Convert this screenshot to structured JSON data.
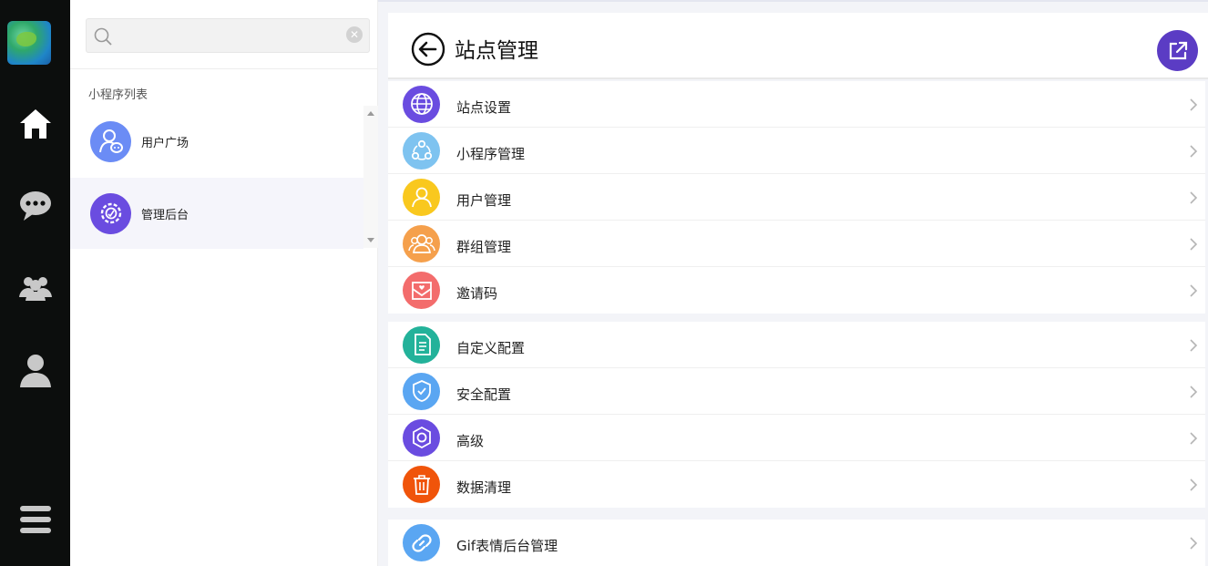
{
  "search": {
    "placeholder": ""
  },
  "sidebar": {
    "section_title": "小程序列表",
    "items": [
      {
        "label": "用户广场",
        "icon": "user-plaza-icon",
        "color": "#6b8cf5"
      },
      {
        "label": "管理后台",
        "icon": "admin-gear-icon",
        "color": "#6a4ce0"
      }
    ]
  },
  "header": {
    "title": "站点管理"
  },
  "menu_groups": [
    [
      {
        "label": "站点设置",
        "icon": "globe-icon",
        "color": "#6a4ce0"
      },
      {
        "label": "小程序管理",
        "icon": "share-nodes-icon",
        "color": "#7ec3f0"
      },
      {
        "label": "用户管理",
        "icon": "user-icon",
        "color": "#f9c81e"
      },
      {
        "label": "群组管理",
        "icon": "group-icon",
        "color": "#f5a04c"
      },
      {
        "label": "邀请码",
        "icon": "envelope-icon",
        "color": "#f36c6c"
      }
    ],
    [
      {
        "label": "自定义配置",
        "icon": "document-icon",
        "color": "#23b29a"
      },
      {
        "label": "安全配置",
        "icon": "shield-check-icon",
        "color": "#5aa6f2"
      },
      {
        "label": "高级",
        "icon": "gear-icon",
        "color": "#6a4ce0"
      },
      {
        "label": "数据清理",
        "icon": "trash-icon",
        "color": "#f0540a"
      }
    ],
    [
      {
        "label": "Gif表情后台管理",
        "icon": "link-icon",
        "color": "#5aa6f2"
      }
    ]
  ]
}
